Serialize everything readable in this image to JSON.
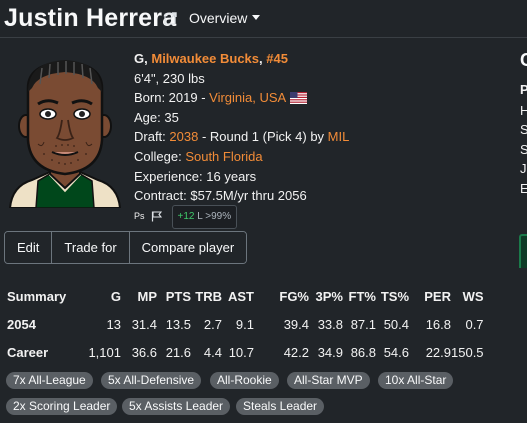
{
  "header": {
    "player_name": "Justin Herrera",
    "view_dropdown": "Overview"
  },
  "bio": {
    "position": "G",
    "team": "Milwaukee Bucks",
    "number": "#45",
    "height_weight": "6'4\", 230 lbs",
    "born_label": "Born: 2019 - ",
    "born_place": "Virginia, USA",
    "age": "Age: 35",
    "draft_label": "Draft: ",
    "draft_year": "2038",
    "draft_detail": " - Round 1 (Pick 4) by ",
    "draft_team": "MIL",
    "college_label": "College: ",
    "college": "South Florida",
    "experience": "Experience: 16 years",
    "contract": "Contract: $57.5M/yr thru 2056",
    "ps_label": "Ps",
    "ovr_change": "+12",
    "ovr_text": " L >99%"
  },
  "actions": {
    "edit": "Edit",
    "trade_for": "Trade for",
    "compare": "Compare player"
  },
  "stats": {
    "headers": [
      "Summary",
      "G",
      "MP",
      "PTS",
      "TRB",
      "AST",
      "FG%",
      "3P%",
      "FT%",
      "TS%",
      "PER",
      "WS"
    ],
    "rows": [
      [
        "2054",
        "13",
        "31.4",
        "13.5",
        "2.7",
        "9.1",
        "39.4",
        "33.8",
        "87.1",
        "50.4",
        "16.8",
        "0.7"
      ],
      [
        "Career",
        "1,101",
        "36.6",
        "21.6",
        "4.4",
        "10.7",
        "42.2",
        "34.9",
        "86.8",
        "54.6",
        "22.9",
        "150.5"
      ]
    ]
  },
  "awards": [
    "7x All-League",
    "5x All-Defensive",
    "All-Rookie",
    "All-Star MVP",
    "10x All-Star",
    "2x Scoring Leader",
    "5x Assists Leader",
    "Steals Leader"
  ],
  "right_panel": {
    "heading": "C",
    "lines": [
      "P",
      "H",
      "S",
      "S",
      "J",
      "E"
    ]
  },
  "colors": {
    "background": "#212529",
    "link": "#f28c38",
    "badge": "#5a5f64",
    "positive": "#3ec96a"
  }
}
